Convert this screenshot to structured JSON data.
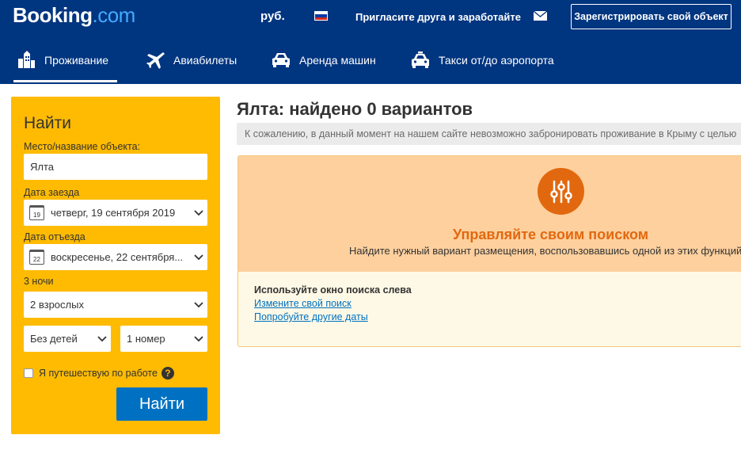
{
  "header": {
    "logo_main": "Booking",
    "logo_suffix": ".com",
    "currency": "руб.",
    "flag_colors": [
      "#ffffff",
      "#0039a6",
      "#d52b1e"
    ],
    "invite_text": "Пригласите друга и заработайте",
    "register_label": "Зарегистрировать свой объект"
  },
  "nav": {
    "tabs": [
      {
        "label": "Проживание",
        "icon": "bed-icon",
        "active": true
      },
      {
        "label": "Авиабилеты",
        "icon": "plane-icon",
        "active": false
      },
      {
        "label": "Аренда машин",
        "icon": "car-icon",
        "active": false
      },
      {
        "label": "Такси от/до аэропорта",
        "icon": "taxi-icon",
        "active": false
      }
    ]
  },
  "search": {
    "title": "Найти",
    "destination_label": "Место/название объекта:",
    "destination_value": "Ялта",
    "checkin_label": "Дата заезда",
    "checkin_day": "19",
    "checkin_value": "четверг, 19 сентября 2019",
    "checkout_label": "Дата отъезда",
    "checkout_day": "22",
    "checkout_value": "воскресенье, 22 сентября...",
    "nights": "3 ночи",
    "adults": "2 взрослых",
    "children": "Без детей",
    "rooms": "1 номер",
    "business_label": "Я путешествую по работе",
    "help_glyph": "?",
    "submit_label": "Найти"
  },
  "results": {
    "title": "Ялта: найдено 0 вариантов",
    "notice": "К сожалению, в данный момент на нашем сайте невозможно забронировать проживание в Крыму с целью",
    "manage_title": "Управляйте своим поиском",
    "manage_subtitle": "Найдите нужный вариант размещения, воспользовавшись одной из этих функций",
    "tips_heading": "Используйте окно поиска слева",
    "link_change": "Измените свой поиск",
    "link_dates": "Попробуйте другие даты"
  },
  "colors": {
    "brand_blue": "#003580",
    "sidebar_yellow": "#febb02",
    "button_blue": "#0071c2",
    "accent_orange": "#e2680f"
  }
}
